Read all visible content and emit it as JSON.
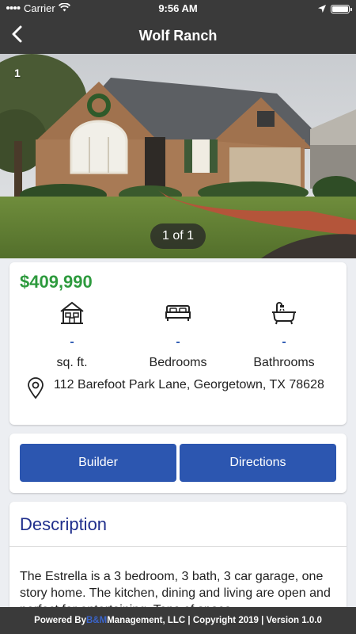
{
  "status_bar": {
    "carrier": "Carrier",
    "time": "9:56 AM"
  },
  "nav": {
    "title": "Wolf Ranch",
    "back_icon": "chevron-left-icon"
  },
  "gallery": {
    "index_label": "1",
    "counter": "1 of 1"
  },
  "listing": {
    "price": "$409,990",
    "price_color": "#2d9a3d",
    "stats": [
      {
        "icon": "house-icon",
        "value": "-",
        "label": "sq. ft."
      },
      {
        "icon": "bed-icon",
        "value": "-",
        "label": "Bedrooms"
      },
      {
        "icon": "bathtub-icon",
        "value": "-",
        "label": "Bathrooms"
      }
    ],
    "address": "112 Barefoot Park Lane, Georgetown, TX 78628"
  },
  "actions": {
    "builder_label": "Builder",
    "directions_label": "Directions",
    "button_color": "#2c56b0"
  },
  "description": {
    "heading": "Description",
    "text": "The Estrella is a 3 bedroom, 3 bath, 3 car garage, one story home. The kitchen, dining and living are open and perfect for entertaining. Tons of space"
  },
  "footer": {
    "prefix": "Powered By ",
    "brand_highlight": "B&M",
    "suffix": " Management, LLC | Copyright 2019 | Version 1.0.0"
  }
}
